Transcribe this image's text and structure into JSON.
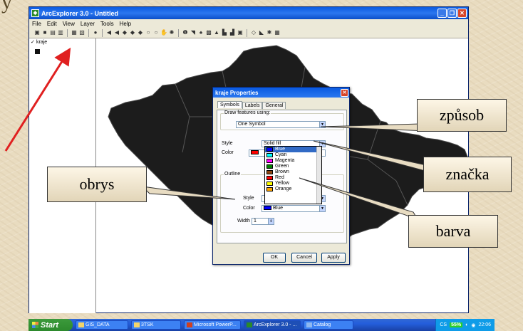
{
  "slide": {
    "title": "y",
    "callouts": {
      "zpusob": "způsob",
      "obrys": "obrys",
      "znacka": "značka",
      "barva": "barva"
    }
  },
  "app": {
    "title": "ArcExplorer 3.0 - Untitled",
    "window_buttons": [
      "_",
      "❐",
      "✕"
    ],
    "menu": [
      "File",
      "Edit",
      "View",
      "Layer",
      "Tools",
      "Help"
    ],
    "layer_name": "kraje",
    "layer_checked": "✓"
  },
  "dialog": {
    "title": "kraje Properties",
    "tabs": [
      "Symbols",
      "Labels",
      "General"
    ],
    "draw_group_label": "Draw features using:",
    "draw_value": "One Symbol",
    "style_label": "Style",
    "style_value": "Solid fill",
    "color_label": "Color",
    "outline_group_label": "Outline",
    "outline_style_label": "Style",
    "outline_color_label": "Color",
    "outline_color_value": "Blue",
    "width_label": "Width",
    "width_value": "1",
    "ok": "OK",
    "cancel": "Cancel",
    "apply": "Apply"
  },
  "color_list": [
    {
      "name": "Blue",
      "color": "#0000ff",
      "selected": true
    },
    {
      "name": "Cyan",
      "color": "#00ffff"
    },
    {
      "name": "Magenta",
      "color": "#ff00ff"
    },
    {
      "name": "Green",
      "color": "#008000"
    },
    {
      "name": "Brown",
      "color": "#8b4513"
    },
    {
      "name": "Red",
      "color": "#ff0000"
    },
    {
      "name": "Yellow",
      "color": "#ffff00"
    },
    {
      "name": "Orange",
      "color": "#ffa500"
    }
  ],
  "taskbar": {
    "start": "Start",
    "tasks": [
      "GIS_DATA",
      "3TSK",
      "Microsoft PowerP...",
      "ArcExplorer 3.0 - ...",
      "Catalog"
    ],
    "lang": "CS",
    "battery": "55%",
    "clock": "22:06"
  }
}
